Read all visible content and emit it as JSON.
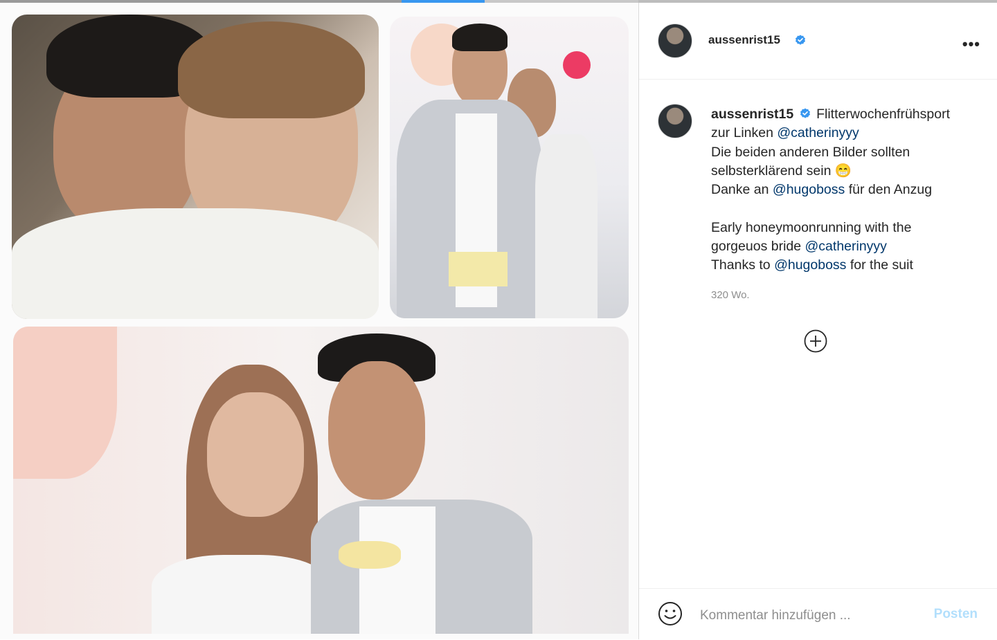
{
  "post": {
    "username": "aussenrist15",
    "verified_icon": "verified-badge-icon",
    "more_icon": "more-horizontal-icon",
    "caption": {
      "username": "aussenrist15",
      "line1": "Flitterwochenfrühsport",
      "line2_text": "zur Linken",
      "line2_mention": "@catherinyyy",
      "line3": "Die beiden anderen Bilder sollten",
      "line4": "selbsterklärend sein 😁",
      "line5_text": "Danke an",
      "line5_mention": "@hugoboss",
      "line5_text2": "für den Anzug",
      "line6": "Early honeymoonrunning with the",
      "line7_text": "gorgeuos bride",
      "line7_mention": "@catherinyyy",
      "line8_text": "Thanks to",
      "line8_mention": "@hugoboss",
      "line8_text2": "for the suit"
    },
    "timestamp": "320 Wo."
  },
  "load_more_icon": "plus-circle-icon",
  "comment": {
    "emoji_icon": "smiley-icon",
    "placeholder": "Kommentar hinzufügen ...",
    "post_label": "Posten"
  },
  "colors": {
    "mention": "#00376b",
    "verified": "#3897f0",
    "post_disabled": "#b2dffc",
    "border": "#dbdbdb"
  }
}
